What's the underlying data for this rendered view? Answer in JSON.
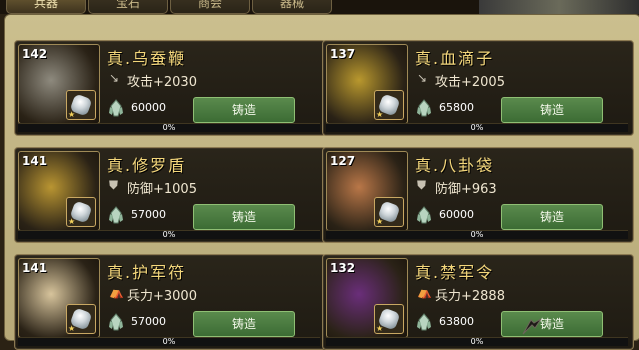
{
  "tabs": [
    {
      "label": "兵器",
      "active": true
    },
    {
      "label": "宝石",
      "active": false
    },
    {
      "label": "商会",
      "active": false
    },
    {
      "label": "器械",
      "active": false
    }
  ],
  "forge_label": "铸造",
  "items": [
    {
      "name": "真.乌蚕鞭",
      "level": "142",
      "stat_icon": "sword-icon",
      "stat": "攻击+2030",
      "cost": "60000",
      "progress": "0%",
      "progress_value": 0,
      "art_color": "#8e8a7e"
    },
    {
      "name": "真.血滴子",
      "level": "137",
      "stat_icon": "sword-icon",
      "stat": "攻击+2005",
      "cost": "65800",
      "progress": "0%",
      "progress_value": 0,
      "art_color": "#b9982e"
    },
    {
      "name": "真.修罗盾",
      "level": "141",
      "stat_icon": "shield-icon",
      "stat": "防御+1005",
      "cost": "57000",
      "progress": "0%",
      "progress_value": 0,
      "art_color": "#b99532"
    },
    {
      "name": "真.八卦袋",
      "level": "127",
      "stat_icon": "shield-icon",
      "stat": "防御+963",
      "cost": "60000",
      "progress": "0%",
      "progress_value": 0,
      "art_color": "#b97748"
    },
    {
      "name": "真.护军符",
      "level": "141",
      "stat_icon": "soldier-icon",
      "stat": "兵力+3000",
      "cost": "57000",
      "progress": "0%",
      "progress_value": 0,
      "art_color": "#d7c49c"
    },
    {
      "name": "真.禁军令",
      "level": "132",
      "stat_icon": "soldier-icon",
      "stat": "兵力+2888",
      "cost": "63800",
      "progress": "0%",
      "progress_value": 0,
      "art_color": "#6a2e7a"
    }
  ]
}
